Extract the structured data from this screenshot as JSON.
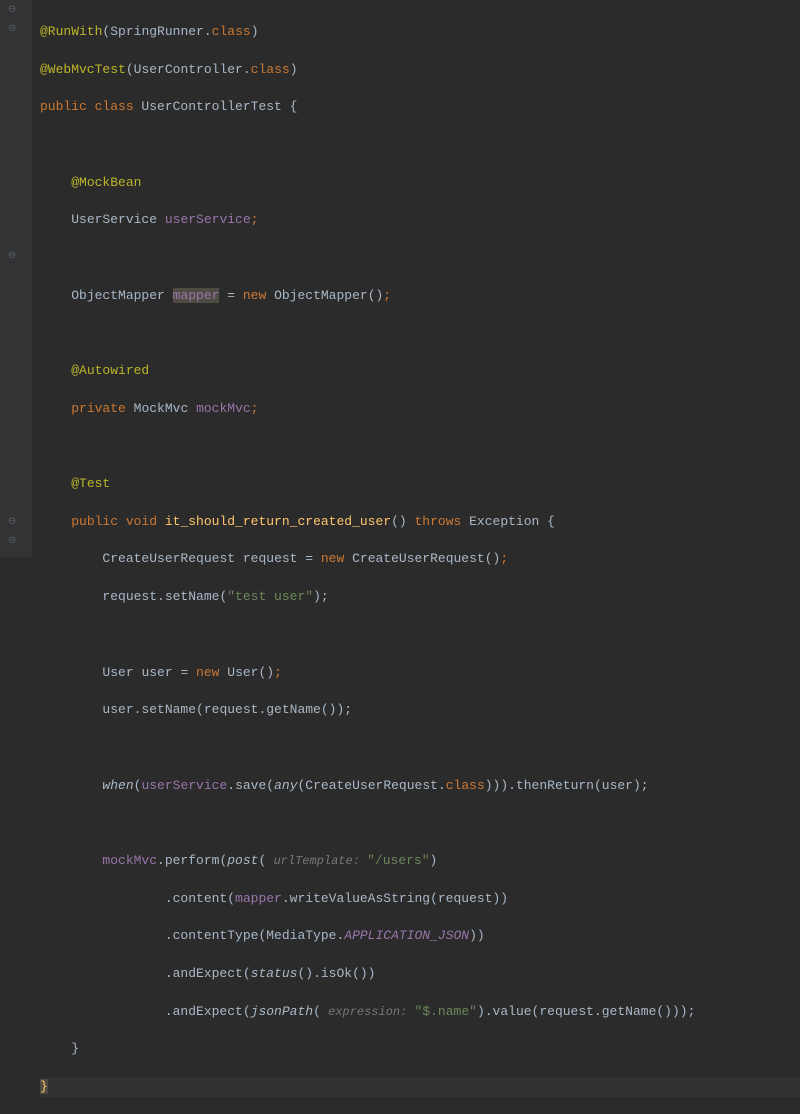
{
  "code": {
    "l1": {
      "ann": "@RunWith",
      "p1": "(",
      "cls": "SpringRunner",
      "p2": ".",
      "kw": "class",
      "p3": ")"
    },
    "l2": {
      "ann": "@WebMvcTest",
      "p1": "(",
      "cls": "UserController",
      "p2": ".",
      "kw": "class",
      "p3": ")"
    },
    "l3": {
      "kw1": "public class ",
      "cls": "UserControllerTest ",
      "brace": "{"
    },
    "l5": {
      "ann": "@MockBean"
    },
    "l6": {
      "type": "UserService ",
      "field": "userService",
      "semi": ";"
    },
    "l8": {
      "type": "ObjectMapper ",
      "field": "mapper",
      "eq": " = ",
      "kw": "new ",
      "ctor": "ObjectMapper()",
      "semi": ";"
    },
    "l10": {
      "ann": "@Autowired"
    },
    "l11": {
      "kw": "private ",
      "type": "MockMvc ",
      "field": "mockMvc",
      "semi": ";"
    },
    "l13": {
      "ann": "@Test"
    },
    "l14": {
      "kw1": "public void ",
      "method": "it_should_return_created_user",
      "p1": "() ",
      "kw2": "throws ",
      "exc": "Exception {"
    },
    "l15": {
      "type": "CreateUserRequest ",
      "var": "request = ",
      "kw": "new ",
      "ctor": "CreateUserRequest()",
      "semi": ";"
    },
    "l16": {
      "var": "request.setName(",
      "str": "\"test user\"",
      "p": ");"
    },
    "l18": {
      "type": "User ",
      "var": "user = ",
      "kw": "new ",
      "ctor": "User()",
      "semi": ";"
    },
    "l19": {
      "txt": "user.setName(request.getName());"
    },
    "l21": {
      "m1": "when",
      "p1": "(",
      "fld": "userService",
      "p2": ".save(",
      "m2": "any",
      "p3": "(CreateUserRequest.",
      "kw": "class",
      "p4": "))).thenReturn(user);"
    },
    "l23": {
      "fld": "mockMvc",
      "p1": ".perform(",
      "m1": "post",
      "p2": "(",
      "hint": " urlTemplate: ",
      "str": "\"/users\"",
      "p3": ")"
    },
    "l24": {
      "p1": ".content(",
      "fld": "mapper",
      "p2": ".writeValueAsString(request))"
    },
    "l25": {
      "p1": ".contentType(MediaType.",
      "sf": "APPLICATION_JSON",
      "p2": "))"
    },
    "l26": {
      "p1": ".andExpect(",
      "m1": "status",
      "p2": "().isOk())"
    },
    "l27": {
      "p1": ".andExpect(",
      "m1": "jsonPath",
      "p2": "(",
      "hint": " expression: ",
      "str": "\"$.name\"",
      "p3": ").value(request.getName()));"
    },
    "l28": {
      "brace": "}"
    },
    "l29": {
      "brace": "}"
    }
  },
  "gutter": {
    "icon_run": "▸",
    "icon_impl": "⬇",
    "icon_fold": "⊖"
  }
}
